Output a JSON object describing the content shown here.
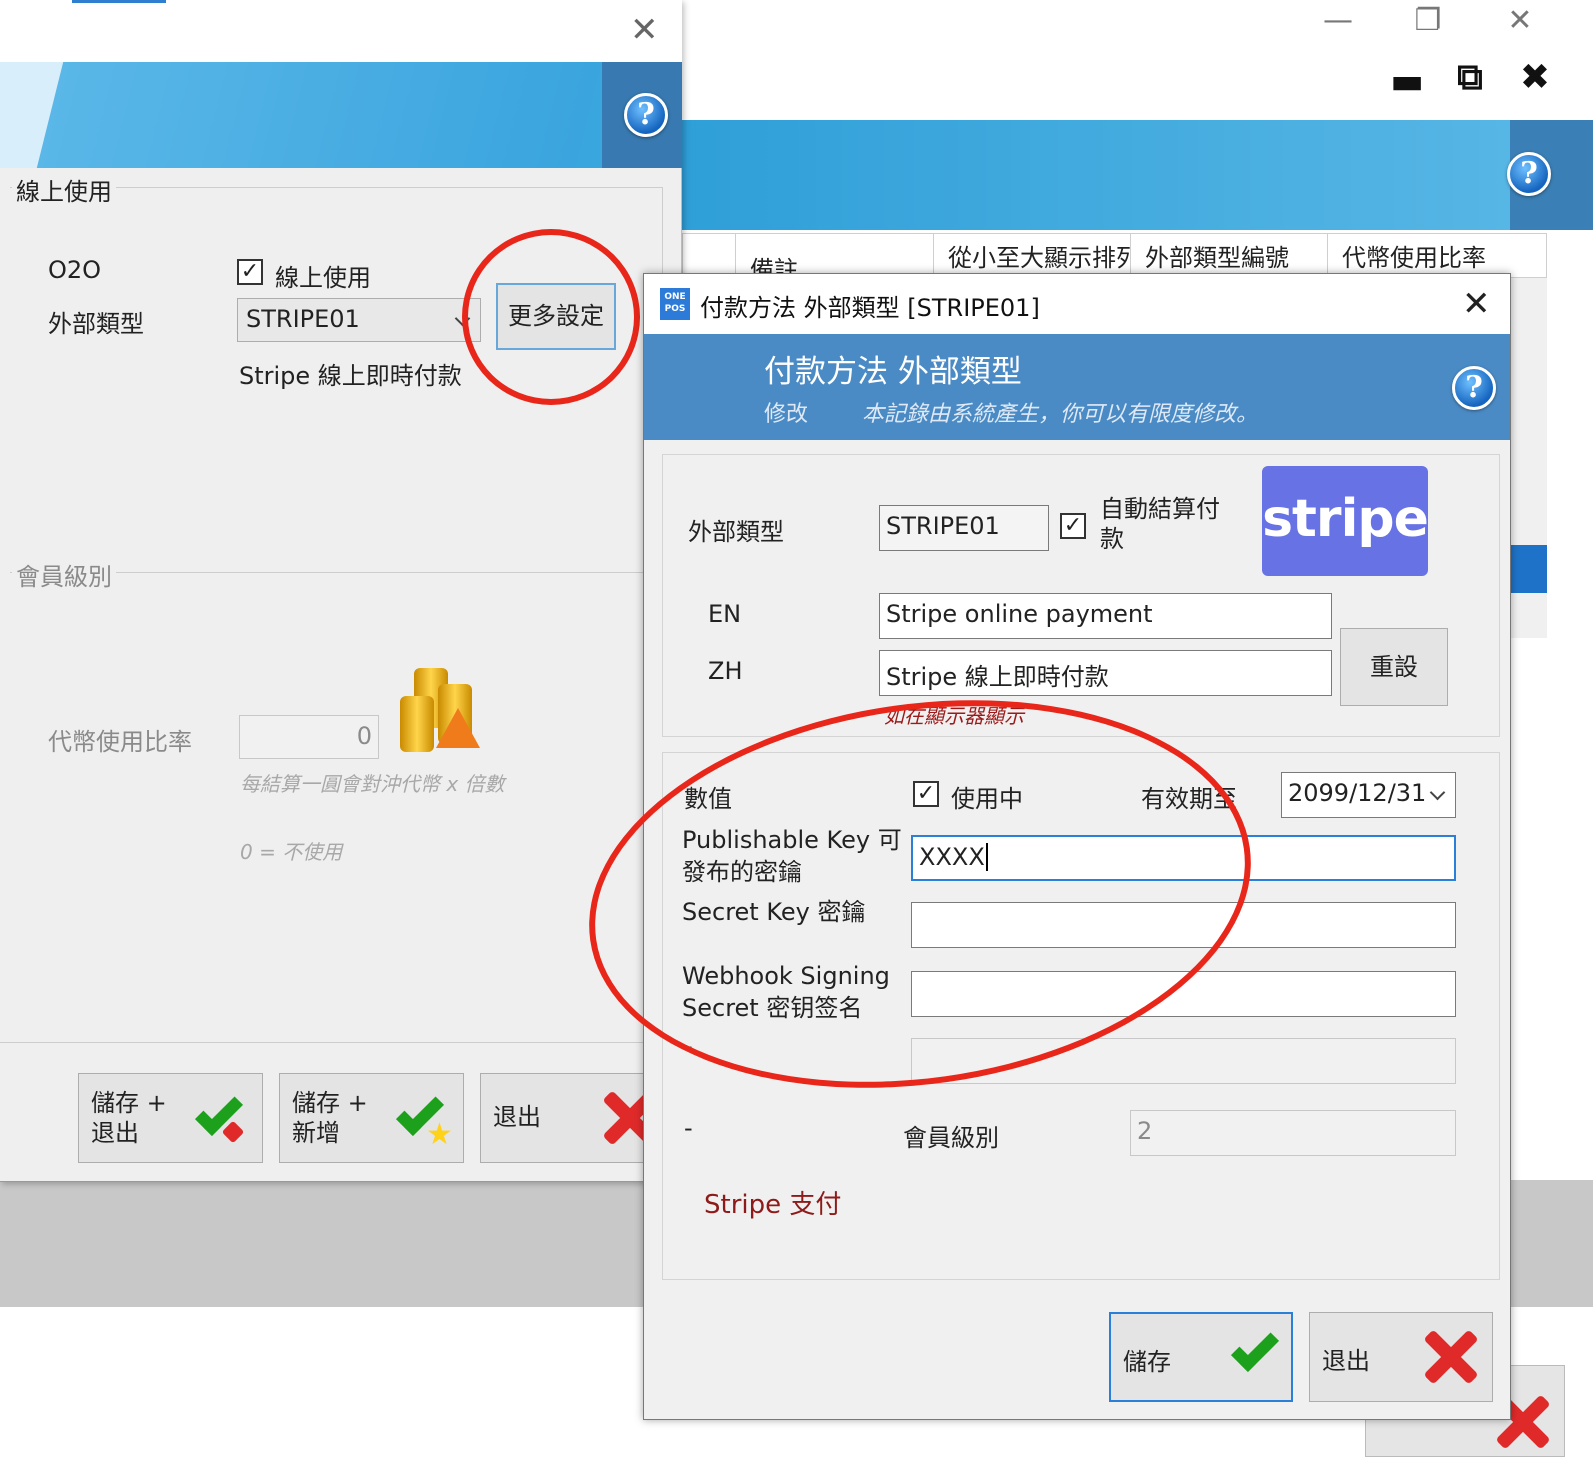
{
  "background_window": {
    "controls": [
      "—",
      "❐",
      "✕"
    ],
    "controls_bold": [
      "▬",
      "⧉",
      "✖"
    ],
    "table_headers": [
      "備註",
      "從小至大顯示排列",
      "外部類型編號",
      "代幣使用比率"
    ],
    "help_icon": "help-icon"
  },
  "left_dialog": {
    "close": "✕",
    "online_group_label": "線上使用",
    "o2o_label": "O2O",
    "online_checkbox_label": "線上使用",
    "external_type_label": "外部類型",
    "external_type_value": "STRIPE01",
    "more_settings_button": "更多設定",
    "external_type_desc": "Stripe 線上即時付款",
    "member_group_label": "會員級別",
    "token_rate_label": "代幣使用比率",
    "token_rate_value": "0",
    "token_hint": "每結算一圓會對沖代幣 x 倍數",
    "token_zero_hint": "0 = 不使用",
    "buttons": {
      "save_exit": [
        "儲存 +",
        "退出"
      ],
      "save_new": [
        "儲存 +",
        "新增"
      ],
      "exit": "退出"
    }
  },
  "fg_dialog": {
    "logo_text": "ONE POS",
    "title": "付款方法 外部類型 [STRIPE01]",
    "close": "✕",
    "header_title": "付款方法 外部類型",
    "header_mode": "修改",
    "header_note": "本記錄由系統產生，你可以有限度修改。",
    "external_type_label": "外部類型",
    "external_type_value": "STRIPE01",
    "auto_settle_label_1": "自動結算付",
    "auto_settle_label_2": "款",
    "stripe_logo_text": "stripe",
    "en_label": "EN",
    "en_value": "Stripe online payment",
    "zh_label": "ZH",
    "zh_value": "Stripe 線上即時付款",
    "reset_button": "重設",
    "display_hint": "如在顯示器顯示",
    "value_label": "數值",
    "in_use_label": "使用中",
    "valid_until_label": "有效期至",
    "valid_until_value": "2099/12/31",
    "publishable_key_label_1": "Publishable Key 可",
    "publishable_key_label_2": "發布的密鑰",
    "publishable_key_value": "XXXX",
    "secret_key_label": "Secret Key 密鑰",
    "secret_key_value": "",
    "webhook_label_1": "Webhook Signing",
    "webhook_label_2": "Secret 密钥签名",
    "webhook_value": "",
    "dash_label_1": "-",
    "dash_label_2": "-",
    "member_level_label": "會員級別",
    "member_level_value": "2",
    "stripe_pay_label": "Stripe 支付",
    "save_button": "儲存",
    "exit_button": "退出"
  },
  "colors": {
    "annotation_red": "#e8271a",
    "header_blue": "#4b8bc5",
    "stripe_purple": "#6772e5",
    "accent_blue": "#2a80d8"
  }
}
